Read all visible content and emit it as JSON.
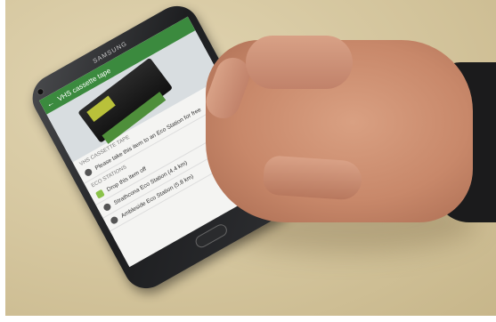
{
  "phone": {
    "brand": "SAMSUNG"
  },
  "app": {
    "title": "VHS cassette tape",
    "item_section": "VHS CASSETTE TAPE",
    "item_message": "Please take this item to an Eco Station for free",
    "stations_section": "ECO STATIONS",
    "stations": [
      {
        "label": "Drop this item off"
      },
      {
        "label": "Strathcona Eco Station (4.4 km)"
      },
      {
        "label": "Ambleside Eco Station (5.8 km)"
      }
    ]
  },
  "colors": {
    "appbar": "#3b8a3e",
    "desk": "#d4c59d"
  }
}
